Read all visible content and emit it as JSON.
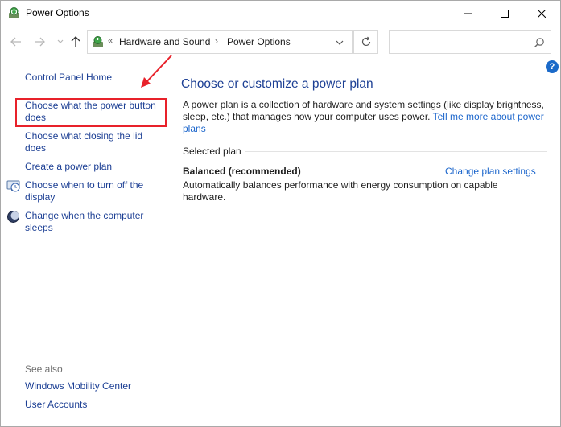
{
  "window": {
    "title": "Power Options",
    "icon": "power-options-icon"
  },
  "address": {
    "chevron": "«",
    "crumbs": [
      "Hardware and Sound",
      "Power Options"
    ],
    "separator": "›"
  },
  "search": {
    "placeholder": ""
  },
  "help": {
    "label": "?"
  },
  "sidebar": {
    "home": "Control Panel Home",
    "items": [
      {
        "label": "Choose what the power button does",
        "icon": ""
      },
      {
        "label": "Choose what closing the lid does",
        "icon": ""
      },
      {
        "label": "Create a power plan",
        "icon": ""
      },
      {
        "label": "Choose when to turn off the display",
        "icon": "display-clock-icon"
      },
      {
        "label": "Change when the computer sleeps",
        "icon": "moon-sleep-icon"
      }
    ],
    "see_also_heading": "See also",
    "see_also": [
      "Windows Mobility Center",
      "User Accounts"
    ]
  },
  "main": {
    "title": "Choose or customize a power plan",
    "description": "A power plan is a collection of hardware and system settings (like display brightness, sleep, etc.) that manages how your computer uses power.",
    "learn_more": "Tell me more about power plans",
    "section_heading": "Selected plan",
    "plan_name": "Balanced (recommended)",
    "change_plan": "Change plan settings",
    "plan_description": "Automatically balances performance with energy consumption on capable hardware."
  },
  "colors": {
    "link": "#1c3f94",
    "highlight": "#e8212a",
    "accent": "#1b6ac9"
  }
}
